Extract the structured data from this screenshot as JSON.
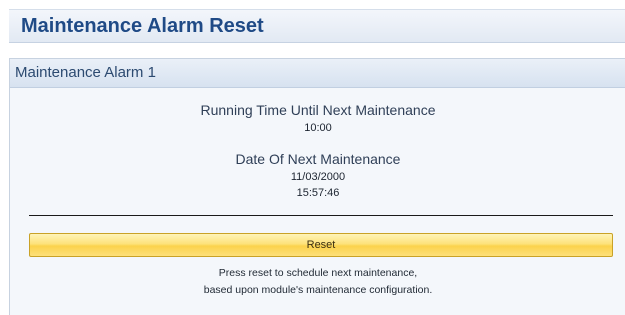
{
  "page": {
    "title": "Maintenance Alarm Reset"
  },
  "panel": {
    "title": "Maintenance Alarm 1",
    "running_time_label": "Running Time Until Next Maintenance",
    "running_time_value": "10:00",
    "date_label": "Date Of Next Maintenance",
    "date_value": "11/03/2000",
    "time_value": "15:57:46",
    "reset_label": "Reset",
    "help_line1": "Press reset to schedule next maintenance,",
    "help_line2": "based upon module's maintenance configuration."
  },
  "colors": {
    "title_blue": "#1f4a86",
    "reset_yellow": "#fbd24c"
  }
}
